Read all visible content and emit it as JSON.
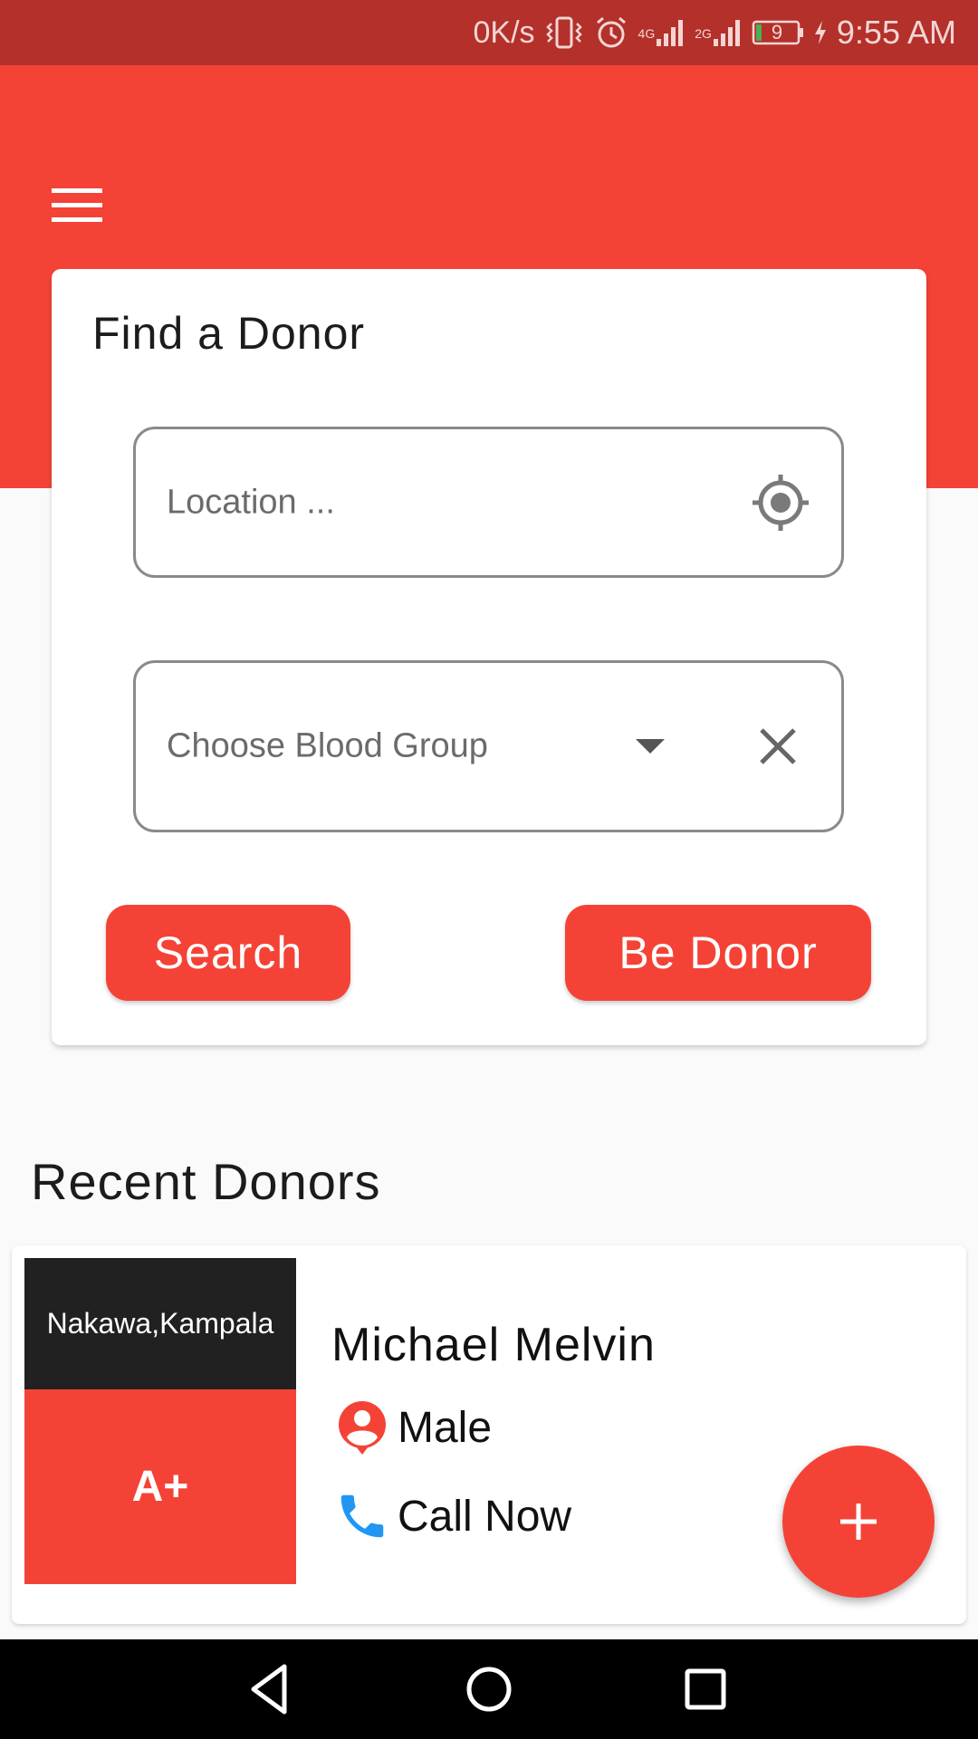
{
  "status_bar": {
    "network_speed": "0K/s",
    "network_4g": "4G",
    "network_2g": "2G",
    "battery_level": "9",
    "time": "9:55 AM",
    "icons": [
      "vibrate-icon",
      "alarm-icon",
      "signal-4g-icon",
      "signal-2g-icon",
      "battery-icon",
      "charging-icon"
    ]
  },
  "app_bar": {
    "menu_icon": "hamburger-menu-icon"
  },
  "find_donor": {
    "title": "Find a Donor",
    "location_placeholder": "Location ...",
    "location_icon": "gps-locate-icon",
    "blood_group_placeholder": "Choose Blood Group",
    "dropdown_icon": "dropdown-arrow-icon",
    "clear_icon": "close-icon",
    "search_label": "Search",
    "be_donor_label": "Be Donor"
  },
  "recent_donors": {
    "title": "Recent Donors",
    "items": [
      {
        "location": "Nakawa,Kampala",
        "blood_group": "A+",
        "name": "Michael Melvin",
        "gender": "Male",
        "call_label": "Call Now"
      }
    ]
  },
  "fab": {
    "icon": "plus-icon"
  },
  "nav_bar": {
    "icons": [
      "back-icon",
      "home-icon",
      "recents-icon"
    ]
  },
  "colors": {
    "primary": "#f44336",
    "status_bar": "#b4302a",
    "location_banner": "#212121",
    "call_icon": "#2196f3"
  }
}
